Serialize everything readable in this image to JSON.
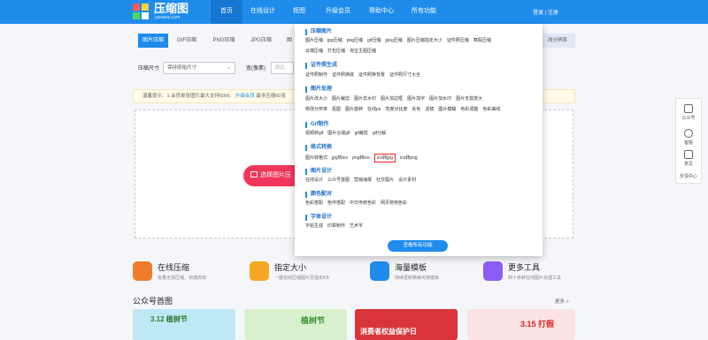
{
  "header": {
    "logo_title": "压缩图",
    "logo_sub": "yasuotu.com",
    "nav": [
      "首页",
      "在线设计",
      "抠图",
      "升级会员",
      "帮助中心",
      "所有功能"
    ],
    "login": "登录 | 注册"
  },
  "tabs": [
    "图片压缩",
    "GIF压缩",
    "PNG压缩",
    "JPG压缩",
    "图"
  ],
  "tab_right": "改分辨率",
  "options": {
    "size_label": "压缩尺寸",
    "size_value": "保持原始尺寸",
    "width_label": "宽(像素)",
    "width_placeholder": "原比"
  },
  "notice": {
    "text": "温馨提示：1.会员单张图片最大支持50M。",
    "link": "升级会员",
    "rest": "最多压缩60张"
  },
  "upload_button": "选择图片压",
  "features": [
    {
      "title": "在线压缩",
      "sub": "批量无损压缩，快捷高效",
      "color": "#f07d2b"
    },
    {
      "title": "指定大小",
      "sub": "一键自动压缩图片至指定KB",
      "color": "#f5a623"
    },
    {
      "title": "海量模板",
      "sub": "持续更新精美可用模板",
      "color": "#1f8cec"
    },
    {
      "title": "更多工具",
      "sub": "四十余种在线图片处理工具",
      "color": "#8b5cf6"
    }
  ],
  "section": {
    "title": "公众号首图",
    "more": "更多 >"
  },
  "thumbs": [
    {
      "text": "3.12 植树节"
    },
    {
      "text": "植树节"
    },
    {
      "text": "消费者权益保护日"
    },
    {
      "text": "3.15 打假"
    }
  ],
  "float_bar": [
    "公众号",
    "客服",
    "意见",
    "反馈中心"
  ],
  "menu": {
    "groups": [
      {
        "title": "压缩图片",
        "rows": [
          [
            "图片压缩",
            "jpg压缩",
            "png压缩",
            "gif压缩",
            "jpeg压缩",
            "图片压缩指定大小",
            "证件照压缩",
            "寒假压缩"
          ],
          [
            "云端压缩",
            "打包压缩",
            "淘宝主图压缩"
          ]
        ]
      },
      {
        "title": "证件照生成",
        "rows": [
          [
            "证件照制作",
            "证件照换底",
            "证件照换背景",
            "证件照尺寸大全"
          ]
        ]
      },
      {
        "title": "图片处理",
        "rows": [
          [
            "图片改大小",
            "图片裁剪",
            "图片去水印",
            "图片加边框",
            "图片加字",
            "图片加水印",
            "图片无损放大"
          ],
          [
            "修改分辨率",
            "抠图",
            "图片旋转",
            "在线ps",
            "亮度对比度",
            "反色",
            "滤镜",
            "图片模糊",
            "色彩调整",
            "色彩曲线"
          ]
        ]
      },
      {
        "title": "Gif制作",
        "rows": [
          [
            "视频转gif",
            "图片合成gif",
            "gif裁剪",
            "gif分解"
          ]
        ]
      },
      {
        "title": "格式转换",
        "rows": [
          [
            "图片转格式",
            "jpg转ico",
            "png转ico",
            "ico转jpg",
            "ico转png"
          ]
        ]
      },
      {
        "title": "图片设计",
        "rows": [
          [
            "在线设计",
            "公众号首图",
            "营销海报",
            "社交图片",
            "设计素材"
          ]
        ]
      },
      {
        "title": "颜色配对",
        "rows": [
          [
            "色彩搭配",
            "色环搭配",
            "中日传统色彩",
            "网页常用色彩"
          ]
        ]
      },
      {
        "title": "字体设计",
        "rows": [
          [
            "字帖生成",
            "印章制作",
            "艺术字"
          ]
        ]
      }
    ],
    "view_all": "查看所有功能"
  },
  "colors": {
    "primary": "#1f8cec",
    "upload": "#f0365a"
  }
}
